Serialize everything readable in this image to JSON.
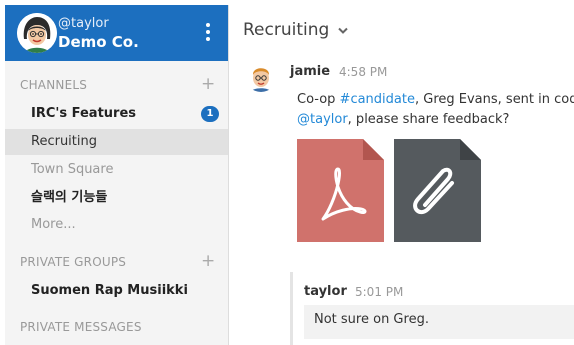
{
  "team": {
    "username": "@taylor",
    "name": "Demo Co."
  },
  "channels": {
    "heading": "CHANNELS",
    "items": [
      {
        "label": "IRC's Features",
        "unread": "1"
      },
      {
        "label": "Recruiting"
      },
      {
        "label": "Town Square"
      },
      {
        "label": "슬랙의 기능들"
      },
      {
        "label": "More..."
      }
    ]
  },
  "private_groups": {
    "heading": "PRIVATE GROUPS",
    "items": [
      {
        "label": "Suomen Rap Musiikki"
      }
    ]
  },
  "private_messages": {
    "heading": "PRIVATE MESSAGES"
  },
  "main": {
    "channel_title": "Recruiting",
    "post": {
      "author": "jamie",
      "time": "4:58 PM",
      "line1_prefix": "Co-op ",
      "line1_tag": "#candidate",
      "line1_rest": ", Greg Evans, sent in code",
      "line2_mention": "@taylor",
      "line2_rest": ", please share feedback?",
      "attachments": [
        {
          "type": "pdf-icon",
          "color": "#d0726c"
        },
        {
          "type": "paperclip-icon",
          "color": "#555a5e"
        }
      ]
    },
    "reply": {
      "author": "taylor",
      "time": "5:01 PM",
      "text": "Not sure on Greg."
    }
  },
  "colors": {
    "accent": "#1c6fbf",
    "link": "#2389d7"
  }
}
